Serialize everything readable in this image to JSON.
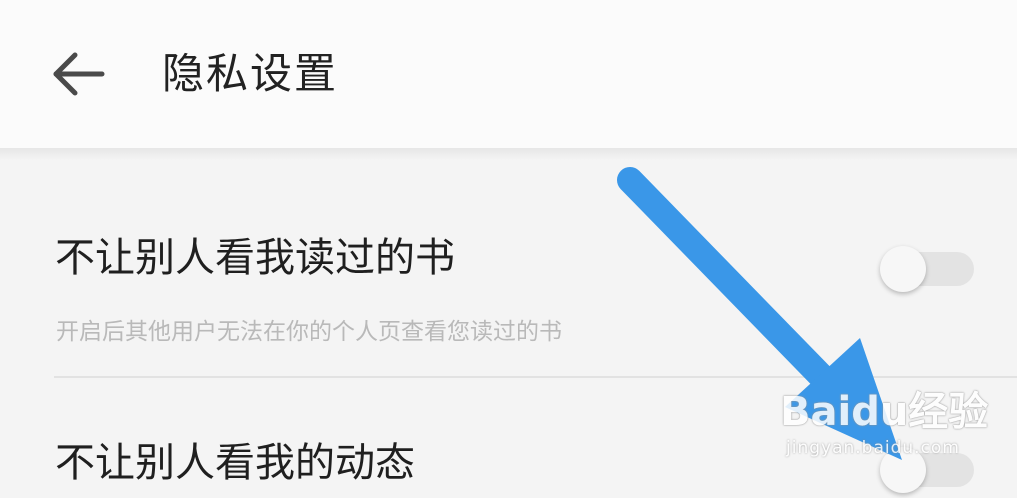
{
  "header": {
    "title": "隐私设置",
    "back_icon": "arrow-left-icon"
  },
  "settings": [
    {
      "title": "不让别人看我读过的书",
      "description": "开启后其他用户无法在你的个人页查看您读过的书",
      "enabled": false
    },
    {
      "title": "不让别人看我的动态",
      "enabled": false
    }
  ],
  "annotation": {
    "type": "arrow",
    "color": "#3a97e8",
    "points_to": "toggle-dynamics"
  },
  "watermark": {
    "logo_text": "Baidu经验",
    "url": "jingyan.baidu.com"
  }
}
